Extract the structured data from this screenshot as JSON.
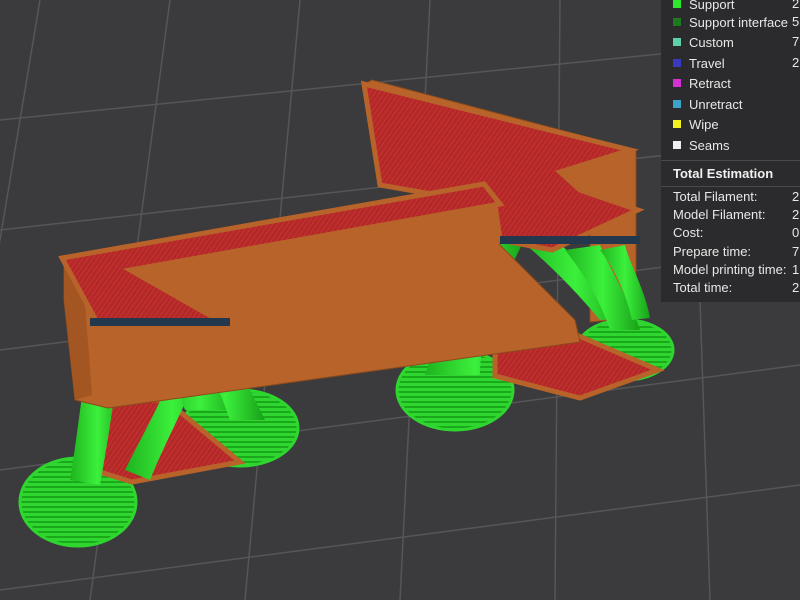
{
  "legend": {
    "items": [
      {
        "label": "Support",
        "value": "2",
        "color": "#2ee82e"
      },
      {
        "label": "Support interface",
        "value": "5",
        "color": "#1e7a1e"
      },
      {
        "label": "Custom",
        "value": "7",
        "color": "#5fd1a8"
      },
      {
        "label": "Travel",
        "value": "2",
        "color": "#3a3ac0"
      },
      {
        "label": "Retract",
        "value": "",
        "color": "#d430d4"
      },
      {
        "label": "Unretract",
        "value": "",
        "color": "#3aa3c8"
      },
      {
        "label": "Wipe",
        "value": "",
        "color": "#f2f21e"
      },
      {
        "label": "Seams",
        "value": "",
        "color": "#f0f0f0"
      }
    ]
  },
  "estimation": {
    "title": "Total Estimation",
    "rows": [
      {
        "label": "Total Filament:",
        "value": "2"
      },
      {
        "label": "Model Filament:",
        "value": "2"
      },
      {
        "label": "Cost:",
        "value": "0"
      },
      {
        "label": "Prepare time:",
        "value": "7"
      },
      {
        "label": "Model printing time:",
        "value": "1"
      },
      {
        "label": "Total time:",
        "value": "2"
      }
    ]
  },
  "colors": {
    "plate": "#3b3b3d",
    "grid": "#555557",
    "wall": "#b8632a",
    "wall_dark": "#8f4a1c",
    "top_fill": "#b22a2a",
    "support": "#2fd62f",
    "support_dark": "#159015"
  }
}
